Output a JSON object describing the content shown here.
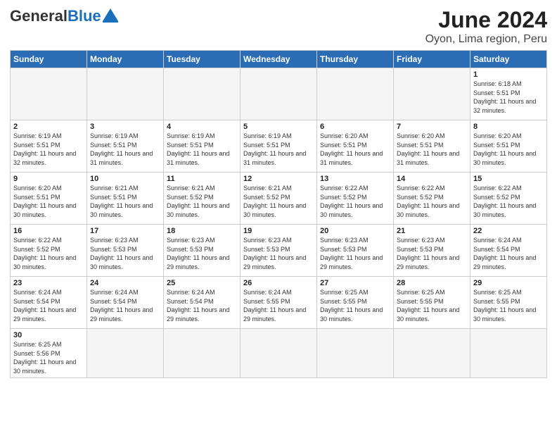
{
  "header": {
    "logo_general": "General",
    "logo_blue": "Blue",
    "title": "June 2024",
    "subtitle": "Oyon, Lima region, Peru"
  },
  "days_of_week": [
    "Sunday",
    "Monday",
    "Tuesday",
    "Wednesday",
    "Thursday",
    "Friday",
    "Saturday"
  ],
  "weeks": [
    [
      {
        "day": "",
        "info": ""
      },
      {
        "day": "",
        "info": ""
      },
      {
        "day": "",
        "info": ""
      },
      {
        "day": "",
        "info": ""
      },
      {
        "day": "",
        "info": ""
      },
      {
        "day": "",
        "info": ""
      },
      {
        "day": "1",
        "info": "Sunrise: 6:18 AM\nSunset: 5:51 PM\nDaylight: 11 hours and 32 minutes."
      }
    ],
    [
      {
        "day": "2",
        "info": "Sunrise: 6:19 AM\nSunset: 5:51 PM\nDaylight: 11 hours and 32 minutes."
      },
      {
        "day": "3",
        "info": "Sunrise: 6:19 AM\nSunset: 5:51 PM\nDaylight: 11 hours and 31 minutes."
      },
      {
        "day": "4",
        "info": "Sunrise: 6:19 AM\nSunset: 5:51 PM\nDaylight: 11 hours and 31 minutes."
      },
      {
        "day": "5",
        "info": "Sunrise: 6:19 AM\nSunset: 5:51 PM\nDaylight: 11 hours and 31 minutes."
      },
      {
        "day": "6",
        "info": "Sunrise: 6:20 AM\nSunset: 5:51 PM\nDaylight: 11 hours and 31 minutes."
      },
      {
        "day": "7",
        "info": "Sunrise: 6:20 AM\nSunset: 5:51 PM\nDaylight: 11 hours and 31 minutes."
      },
      {
        "day": "8",
        "info": "Sunrise: 6:20 AM\nSunset: 5:51 PM\nDaylight: 11 hours and 30 minutes."
      }
    ],
    [
      {
        "day": "9",
        "info": "Sunrise: 6:20 AM\nSunset: 5:51 PM\nDaylight: 11 hours and 30 minutes."
      },
      {
        "day": "10",
        "info": "Sunrise: 6:21 AM\nSunset: 5:51 PM\nDaylight: 11 hours and 30 minutes."
      },
      {
        "day": "11",
        "info": "Sunrise: 6:21 AM\nSunset: 5:52 PM\nDaylight: 11 hours and 30 minutes."
      },
      {
        "day": "12",
        "info": "Sunrise: 6:21 AM\nSunset: 5:52 PM\nDaylight: 11 hours and 30 minutes."
      },
      {
        "day": "13",
        "info": "Sunrise: 6:22 AM\nSunset: 5:52 PM\nDaylight: 11 hours and 30 minutes."
      },
      {
        "day": "14",
        "info": "Sunrise: 6:22 AM\nSunset: 5:52 PM\nDaylight: 11 hours and 30 minutes."
      },
      {
        "day": "15",
        "info": "Sunrise: 6:22 AM\nSunset: 5:52 PM\nDaylight: 11 hours and 30 minutes."
      }
    ],
    [
      {
        "day": "16",
        "info": "Sunrise: 6:22 AM\nSunset: 5:52 PM\nDaylight: 11 hours and 30 minutes."
      },
      {
        "day": "17",
        "info": "Sunrise: 6:23 AM\nSunset: 5:53 PM\nDaylight: 11 hours and 30 minutes."
      },
      {
        "day": "18",
        "info": "Sunrise: 6:23 AM\nSunset: 5:53 PM\nDaylight: 11 hours and 29 minutes."
      },
      {
        "day": "19",
        "info": "Sunrise: 6:23 AM\nSunset: 5:53 PM\nDaylight: 11 hours and 29 minutes."
      },
      {
        "day": "20",
        "info": "Sunrise: 6:23 AM\nSunset: 5:53 PM\nDaylight: 11 hours and 29 minutes."
      },
      {
        "day": "21",
        "info": "Sunrise: 6:23 AM\nSunset: 5:53 PM\nDaylight: 11 hours and 29 minutes."
      },
      {
        "day": "22",
        "info": "Sunrise: 6:24 AM\nSunset: 5:54 PM\nDaylight: 11 hours and 29 minutes."
      }
    ],
    [
      {
        "day": "23",
        "info": "Sunrise: 6:24 AM\nSunset: 5:54 PM\nDaylight: 11 hours and 29 minutes."
      },
      {
        "day": "24",
        "info": "Sunrise: 6:24 AM\nSunset: 5:54 PM\nDaylight: 11 hours and 29 minutes."
      },
      {
        "day": "25",
        "info": "Sunrise: 6:24 AM\nSunset: 5:54 PM\nDaylight: 11 hours and 29 minutes."
      },
      {
        "day": "26",
        "info": "Sunrise: 6:24 AM\nSunset: 5:55 PM\nDaylight: 11 hours and 29 minutes."
      },
      {
        "day": "27",
        "info": "Sunrise: 6:25 AM\nSunset: 5:55 PM\nDaylight: 11 hours and 30 minutes."
      },
      {
        "day": "28",
        "info": "Sunrise: 6:25 AM\nSunset: 5:55 PM\nDaylight: 11 hours and 30 minutes."
      },
      {
        "day": "29",
        "info": "Sunrise: 6:25 AM\nSunset: 5:55 PM\nDaylight: 11 hours and 30 minutes."
      }
    ],
    [
      {
        "day": "30",
        "info": "Sunrise: 6:25 AM\nSunset: 5:56 PM\nDaylight: 11 hours and 30 minutes."
      },
      {
        "day": "",
        "info": ""
      },
      {
        "day": "",
        "info": ""
      },
      {
        "day": "",
        "info": ""
      },
      {
        "day": "",
        "info": ""
      },
      {
        "day": "",
        "info": ""
      },
      {
        "day": "",
        "info": ""
      }
    ]
  ]
}
